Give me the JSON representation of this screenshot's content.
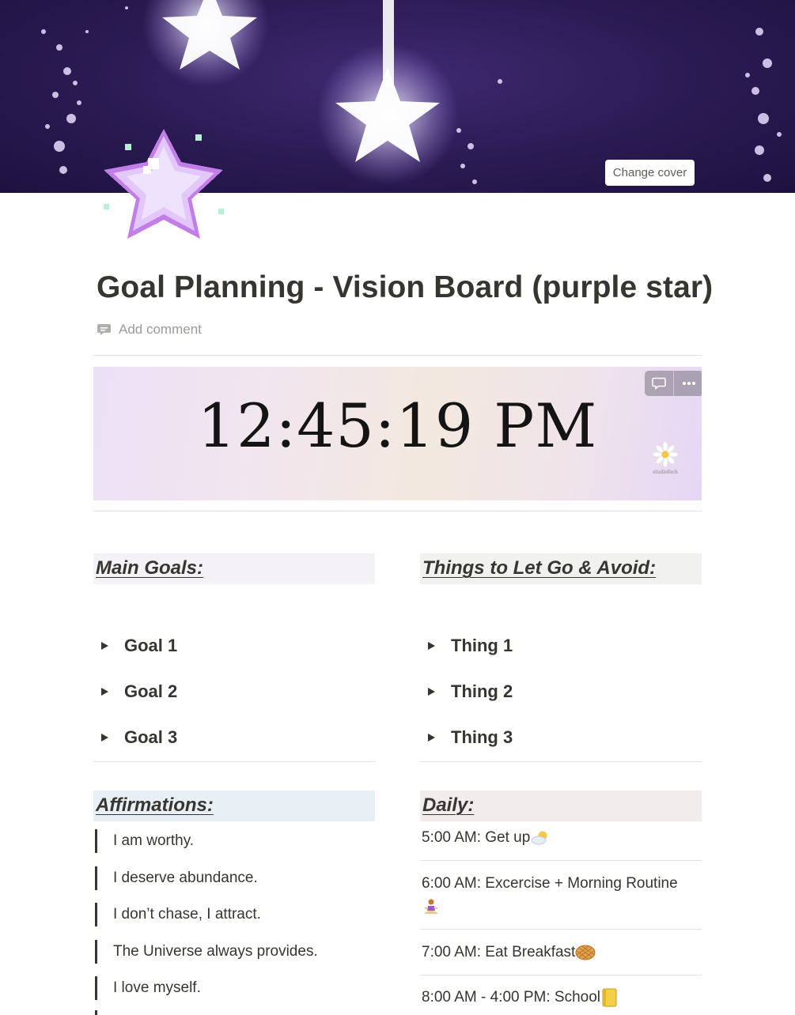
{
  "cover": {
    "change_cover_label": "Change cover"
  },
  "page": {
    "title": "Goal Planning - Vision Board (purple star)",
    "add_comment_label": "Add comment",
    "page_icon": "purple-pixel-star-icon"
  },
  "clock_widget": {
    "time": "12:45:19 PM",
    "brand": "studiofach",
    "colors": {
      "gradient_start": "#ece0f6",
      "gradient_mid": "#f3e8df",
      "gradient_end": "#e6d6f6"
    }
  },
  "main_goals": {
    "heading": "Main Goals:",
    "items": [
      {
        "label": "Goal 1"
      },
      {
        "label": "Goal 2"
      },
      {
        "label": "Goal 3"
      }
    ]
  },
  "let_go": {
    "heading": "Things to Let Go & Avoid:",
    "items": [
      {
        "label": "Thing 1"
      },
      {
        "label": "Thing 2"
      },
      {
        "label": "Thing 3"
      }
    ]
  },
  "affirmations": {
    "heading": "Affirmations:",
    "items": [
      "I am worthy.",
      "I deserve abundance.",
      "I don’t chase, I attract.",
      "The Universe always provides.",
      "I love myself."
    ]
  },
  "daily": {
    "heading": "Daily:",
    "items": [
      {
        "text": "5:00 AM: Get up",
        "emoji": "sun-behind-cloud"
      },
      {
        "text": "6:00 AM: Excercise + Morning Routine",
        "emoji": "person-in-lotus-position"
      },
      {
        "text": "7:00 AM: Eat Breakfast",
        "emoji": "waffle"
      },
      {
        "text": "8:00 AM - 4:00 PM: School",
        "emoji": "notebook"
      }
    ]
  },
  "colors": {
    "text": "#37352f",
    "muted": "#9b9a97",
    "main_goals_bg": "#f4f2f7",
    "let_go_bg": "#f1f1ef",
    "affirmations_bg": "#e8f0f6",
    "daily_bg": "#f3ecec",
    "cover_bg": "#2a1a52"
  }
}
